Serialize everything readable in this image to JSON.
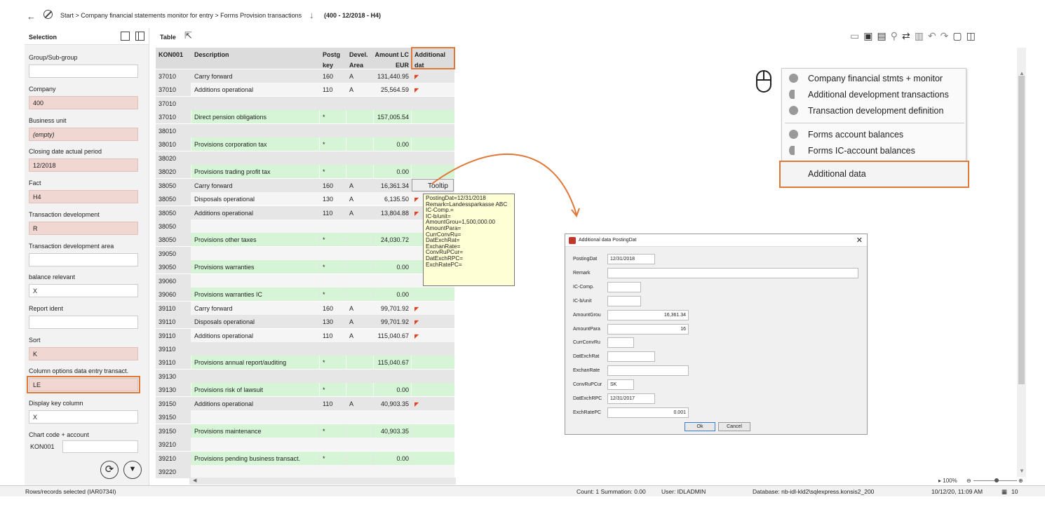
{
  "breadcrumb": {
    "path": "Start > Company financial statements monitor for entry > Forms Provision transactions",
    "context": "(400 - 12/2018 - H4)"
  },
  "selection": {
    "title": "Selection",
    "fields": [
      {
        "label": "Group/Sub-group",
        "value": ""
      },
      {
        "label": "Company",
        "value": "400"
      },
      {
        "label": "Business unit",
        "value": "(empty)"
      },
      {
        "label": "Closing date actual period",
        "value": "12/2018"
      },
      {
        "label": "Fact",
        "value": "H4"
      },
      {
        "label": "Transaction development",
        "value": "R"
      },
      {
        "label": "Transaction development area",
        "value": ""
      },
      {
        "label": "balance relevant",
        "value": "X"
      },
      {
        "label": "Report ident",
        "value": ""
      },
      {
        "label": "Sort",
        "value": "K"
      },
      {
        "label": "Column options data entry transact.",
        "value": "LE"
      },
      {
        "label": "Display key column",
        "value": "X"
      },
      {
        "label": "Chart code + account",
        "value": ""
      }
    ],
    "chart_code_key": "KON001"
  },
  "table": {
    "title": "Table",
    "headers": {
      "c0": "KON001",
      "c1": "Description",
      "c2a": "Postg",
      "c2b": "key",
      "c3a": "Devel.",
      "c3b": "Area",
      "c4a": "Amount LC",
      "c4b": "EUR",
      "c5": "Additional dat"
    },
    "rows": [
      {
        "k": "37010",
        "d": "Carry forward",
        "p": "160",
        "a": "A",
        "amt": "131,440.95",
        "f": true,
        "g": false
      },
      {
        "k": "37010",
        "d": "Additions operational",
        "p": "110",
        "a": "A",
        "amt": "25,564.59",
        "f": true,
        "g": false
      },
      {
        "k": "37010",
        "d": "",
        "p": "",
        "a": "",
        "amt": "",
        "f": false,
        "g": false
      },
      {
        "k": "37010",
        "d": "Direct pension obligations",
        "p": "*",
        "a": "",
        "amt": "157,005.54",
        "f": false,
        "g": true
      },
      {
        "k": "38010",
        "d": "",
        "p": "",
        "a": "",
        "amt": "",
        "f": false,
        "g": false
      },
      {
        "k": "38010",
        "d": "Provisions  corporation tax",
        "p": "*",
        "a": "",
        "amt": "0.00",
        "f": false,
        "g": true
      },
      {
        "k": "38020",
        "d": "",
        "p": "",
        "a": "",
        "amt": "",
        "f": false,
        "g": false
      },
      {
        "k": "38020",
        "d": "Provisions trading profit tax",
        "p": "*",
        "a": "",
        "amt": "0.00",
        "f": false,
        "g": true
      },
      {
        "k": "38050",
        "d": "Carry forward",
        "p": "160",
        "a": "A",
        "amt": "16,361.34",
        "f": true,
        "g": false
      },
      {
        "k": "38050",
        "d": "Disposals operational",
        "p": "130",
        "a": "A",
        "amt": "6,135.50",
        "f": true,
        "g": false
      },
      {
        "k": "38050",
        "d": "Additions operational",
        "p": "110",
        "a": "A",
        "amt": "13,804.88",
        "f": true,
        "g": false
      },
      {
        "k": "38050",
        "d": "",
        "p": "",
        "a": "",
        "amt": "",
        "f": false,
        "g": false
      },
      {
        "k": "38050",
        "d": "Provisions other taxes",
        "p": "*",
        "a": "",
        "amt": "24,030.72",
        "f": false,
        "g": true
      },
      {
        "k": "39050",
        "d": "",
        "p": "",
        "a": "",
        "amt": "",
        "f": false,
        "g": false
      },
      {
        "k": "39050",
        "d": "Provisions warranties",
        "p": "*",
        "a": "",
        "amt": "0.00",
        "f": false,
        "g": true
      },
      {
        "k": "39060",
        "d": "",
        "p": "",
        "a": "",
        "amt": "",
        "f": false,
        "g": false
      },
      {
        "k": "39060",
        "d": "Provisions warranties IC",
        "p": "*",
        "a": "",
        "amt": "0.00",
        "f": false,
        "g": true
      },
      {
        "k": "39110",
        "d": "Carry forward",
        "p": "160",
        "a": "A",
        "amt": "99,701.92",
        "f": true,
        "g": false
      },
      {
        "k": "39110",
        "d": "Disposals operational",
        "p": "130",
        "a": "A",
        "amt": "99,701.92",
        "f": true,
        "g": false
      },
      {
        "k": "39110",
        "d": "Additions operational",
        "p": "110",
        "a": "A",
        "amt": "115,040.67",
        "f": true,
        "g": false
      },
      {
        "k": "39110",
        "d": "",
        "p": "",
        "a": "",
        "amt": "",
        "f": false,
        "g": false
      },
      {
        "k": "39110",
        "d": "Provisions annual report/auditing",
        "p": "*",
        "a": "",
        "amt": "115,040.67",
        "f": false,
        "g": true
      },
      {
        "k": "39130",
        "d": "",
        "p": "",
        "a": "",
        "amt": "",
        "f": false,
        "g": false
      },
      {
        "k": "39130",
        "d": "Provisions risk of lawsuit",
        "p": "*",
        "a": "",
        "amt": "0.00",
        "f": false,
        "g": true
      },
      {
        "k": "39150",
        "d": "Additions operational",
        "p": "110",
        "a": "A",
        "amt": "40,903.35",
        "f": true,
        "g": false
      },
      {
        "k": "39150",
        "d": "",
        "p": "",
        "a": "",
        "amt": "",
        "f": false,
        "g": false
      },
      {
        "k": "39150",
        "d": "Provisions maintenance",
        "p": "*",
        "a": "",
        "amt": "40,903.35",
        "f": false,
        "g": true
      },
      {
        "k": "39210",
        "d": "",
        "p": "",
        "a": "",
        "amt": "",
        "f": false,
        "g": false
      },
      {
        "k": "39210",
        "d": "Provisions pending business transact.",
        "p": "*",
        "a": "",
        "amt": "0.00",
        "f": false,
        "g": true
      },
      {
        "k": "39220",
        "d": "",
        "p": "",
        "a": "",
        "amt": "",
        "f": false,
        "g": false
      }
    ]
  },
  "tooltip": {
    "label": "Tooltip",
    "lines": [
      "PostingDat=12/31/2018",
      "Remark=Landessparkasse ABC",
      "IC-Comp.=",
      "IC-b/unit=",
      "AmountGrou=1,500,000.00",
      "AmountPara=",
      "CurrConvRu=",
      "DatExchRat=",
      "ExchanRate=",
      "ConvRuPCur=",
      "DatExchRPC=",
      "ExchRatePC="
    ]
  },
  "context_menu": {
    "items": [
      "Company financial stmts + monitor",
      "Additional development transactions",
      "Transaction development definition",
      "Forms account balances",
      "Forms IC-account balances",
      "Additional data"
    ]
  },
  "dialog": {
    "title": "Additional data PostingDat",
    "fields": [
      {
        "label": "PostingDat",
        "value": "12/31/2018"
      },
      {
        "label": "Remark",
        "value": ""
      },
      {
        "label": "IC-Comp.",
        "value": ""
      },
      {
        "label": "IC-b/unit",
        "value": ""
      },
      {
        "label": "AmountGrou",
        "value": "16,361.34"
      },
      {
        "label": "AmountPara",
        "value": "16"
      },
      {
        "label": "CurrConvRu",
        "value": ""
      },
      {
        "label": "DatExchRat",
        "value": ""
      },
      {
        "label": "ExchanRate",
        "value": ""
      },
      {
        "label": "ConvRuPCur",
        "value": "SK"
      },
      {
        "label": "DatExchRPC",
        "value": "12/31/2017"
      },
      {
        "label": "ExchRatePC",
        "value": "0.001"
      }
    ],
    "ok": "Ok",
    "cancel": "Cancel"
  },
  "zoom": "100%",
  "status": {
    "left": "Rows/records selected (IAR0734I)",
    "count": "Count: 1 Summation: 0.00",
    "user": "User: IDLADMIN",
    "database": "Database: nb-idl-kld2\\sqlexpress.konsis2_200",
    "datetime": "10/12/20, 11:09 AM",
    "pages": "10"
  },
  "colors": {
    "accent": "#e0783a",
    "pink_field": "#f0d7d2",
    "green_row": "#d6f5d6",
    "flag": "#e2401e",
    "tooltip_bg": "#ffffd6"
  }
}
